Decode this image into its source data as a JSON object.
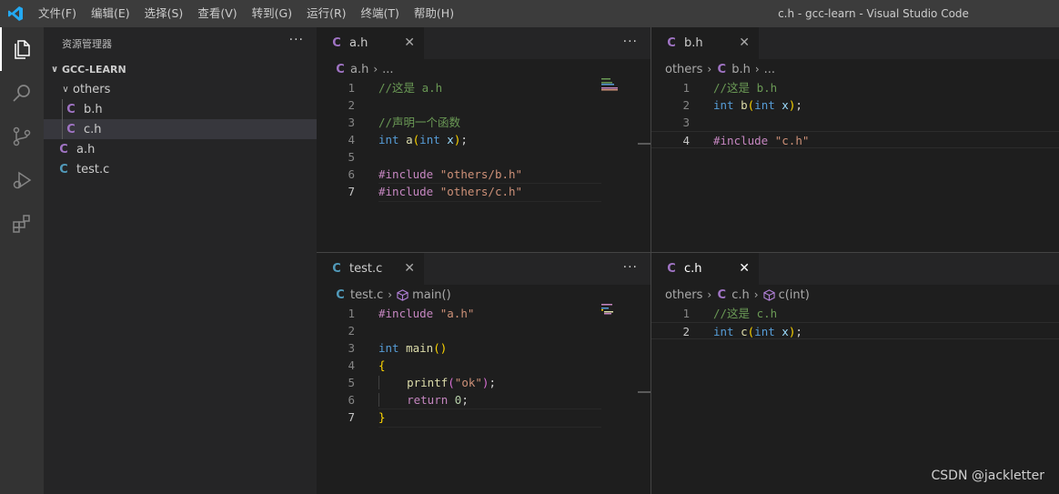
{
  "titlebar": {
    "menu": [
      "文件(F)",
      "编辑(E)",
      "选择(S)",
      "查看(V)",
      "转到(G)",
      "运行(R)",
      "终端(T)",
      "帮助(H)"
    ],
    "window_title": "c.h - gcc-learn - Visual Studio Code"
  },
  "sidebar": {
    "title": "资源管理器",
    "more": "···",
    "root": "GCC-LEARN",
    "folder": "others",
    "files": [
      "b.h",
      "c.h",
      "a.h",
      "test.c"
    ],
    "file_icon": "C"
  },
  "groups": {
    "a": {
      "tab": "a.h",
      "close": "✕",
      "more": "···",
      "breadcrumb": [
        "a.h",
        "..."
      ],
      "lines": [
        {
          "n": "1",
          "comment": "//这是 a.h"
        },
        {
          "n": "2"
        },
        {
          "n": "3",
          "comment": "//声明一个函数"
        },
        {
          "n": "4",
          "kw": "int",
          "fn": "a",
          "open": "(",
          "kw2": "int",
          "param": "x",
          "close": ")",
          "end": ";"
        },
        {
          "n": "5"
        },
        {
          "n": "6",
          "inc": "#include",
          "str": "\"others/b.h\""
        },
        {
          "n": "7",
          "inc": "#include",
          "str": "\"others/c.h\""
        }
      ]
    },
    "b": {
      "tab": "b.h",
      "close": "✕",
      "breadcrumb": [
        "others",
        "b.h",
        "..."
      ],
      "lines": [
        {
          "n": "1",
          "comment": "//这是 b.h"
        },
        {
          "n": "2",
          "kw": "int",
          "fn": "b",
          "open": "(",
          "kw2": "int",
          "param": "x",
          "close": ")",
          "end": ";"
        },
        {
          "n": "3"
        },
        {
          "n": "4",
          "inc": "#include",
          "str": "\"c.h\""
        }
      ]
    },
    "test": {
      "tab": "test.c",
      "close": "✕",
      "more": "···",
      "breadcrumb": [
        "test.c",
        "main()"
      ],
      "lines": [
        {
          "n": "1",
          "inc": "#include",
          "str": "\"a.h\""
        },
        {
          "n": "2"
        },
        {
          "n": "3",
          "kw": "int",
          "fn": "main",
          "parens": "()"
        },
        {
          "n": "4",
          "brace": "{"
        },
        {
          "n": "5",
          "fn": "printf",
          "open": "(",
          "str": "\"ok\"",
          "close": ")",
          "end": ";"
        },
        {
          "n": "6",
          "kw": "return",
          "num": "0",
          "end": ";"
        },
        {
          "n": "7",
          "brace": "}"
        }
      ]
    },
    "c": {
      "tab": "c.h",
      "close": "✕",
      "breadcrumb": [
        "others",
        "c.h",
        "c(int)"
      ],
      "lines": [
        {
          "n": "1",
          "comment": "//这是 c.h"
        },
        {
          "n": "2",
          "kw": "int",
          "fn": "c",
          "open": "(",
          "kw2": "int",
          "param": "x",
          "close": ")",
          "end": ";"
        }
      ]
    }
  },
  "watermark": "CSDN @jackletter",
  "colors": {
    "titlebar": "#3c3c3c",
    "activitybar": "#333333",
    "sidebar": "#252526",
    "editor": "#1e1e1e",
    "accent_c_header": "#a074c4",
    "accent_c_source": "#519aba"
  }
}
